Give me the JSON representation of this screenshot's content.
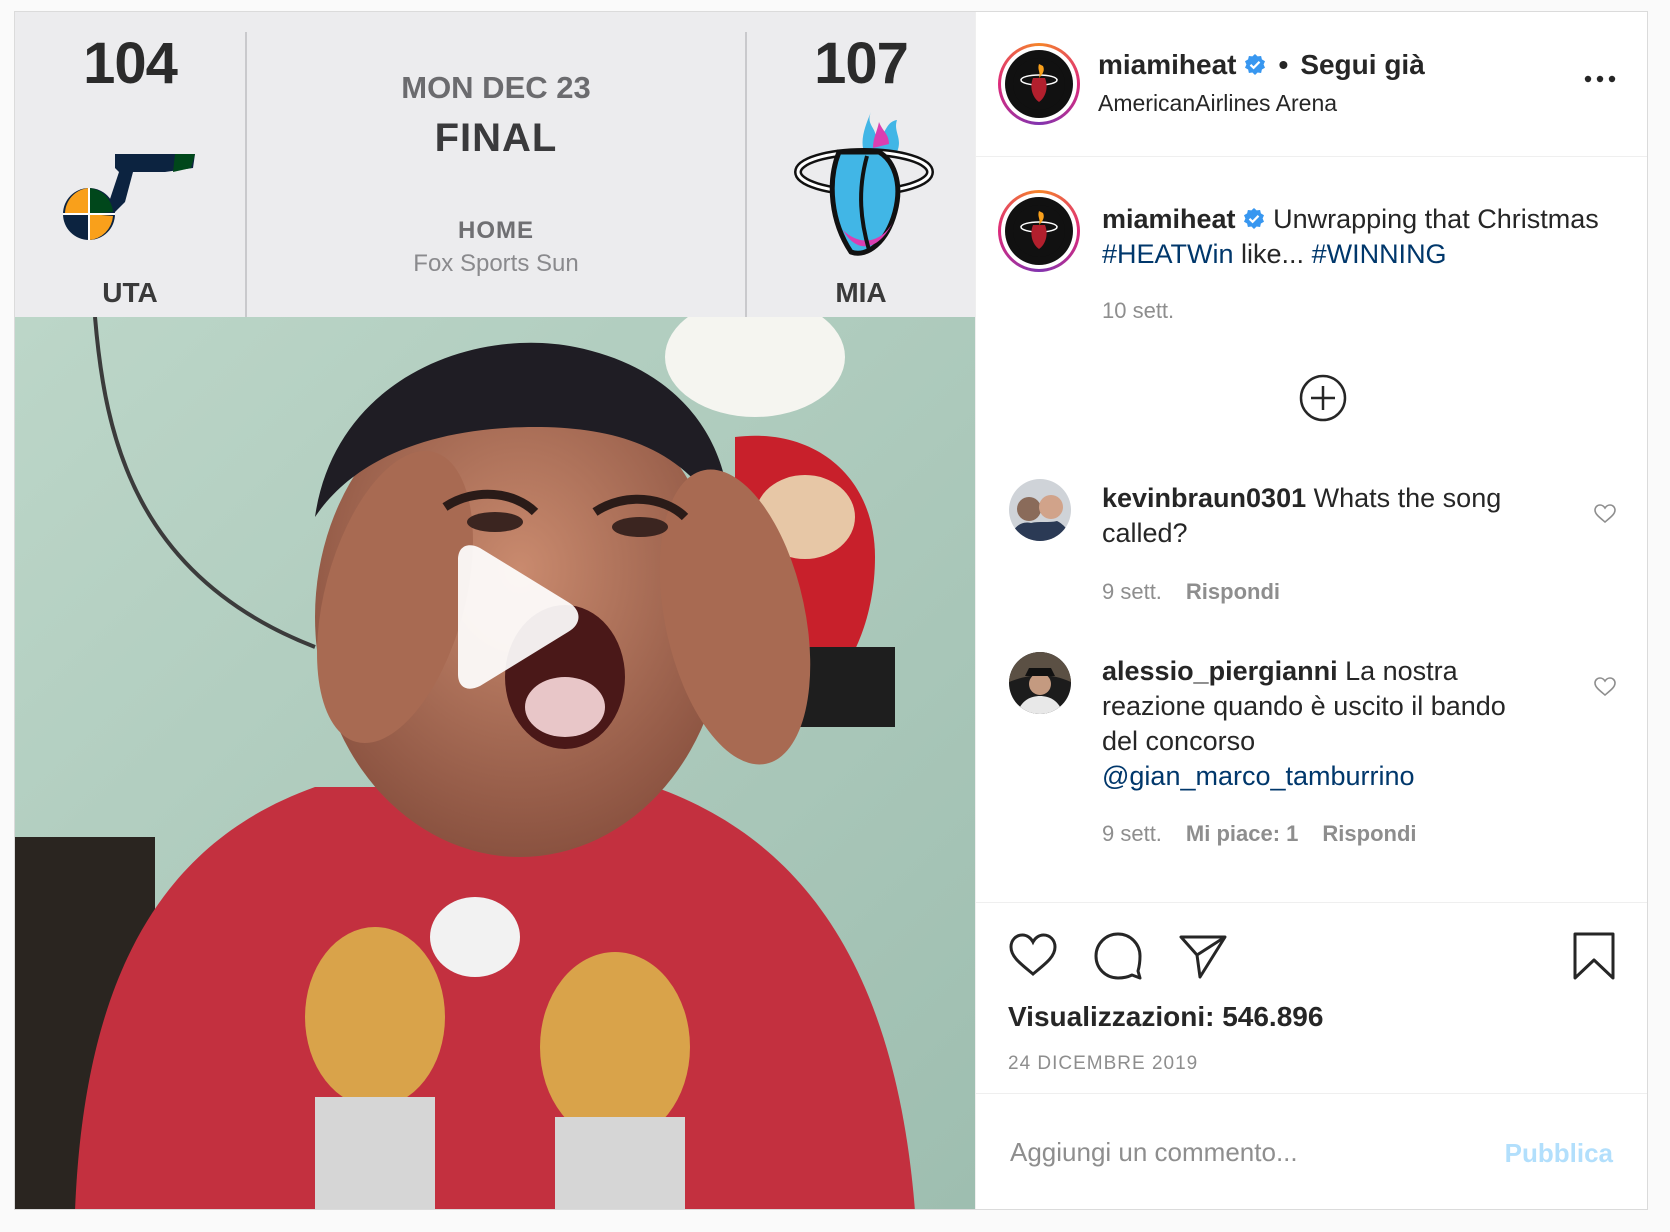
{
  "scoreboard": {
    "away": {
      "score": "104",
      "abbr": "UTA",
      "logo_icon": "utah-jazz-logo-icon"
    },
    "home": {
      "score": "107",
      "abbr": "MIA",
      "logo_icon": "miami-heat-logo-icon"
    },
    "date": "MON DEC 23",
    "status": "FINAL",
    "home_label": "HOME",
    "network": "Fox Sports Sun"
  },
  "header": {
    "username": "miamiheat",
    "separator": "•",
    "follow_label": "Segui già",
    "location": "AmericanAirlines Arena"
  },
  "caption": {
    "username": "miamiheat",
    "text_before": "Unwrapping that Christmas ",
    "hashtag1": "#HEATWin",
    "text_middle": " like... ",
    "hashtag2": "#WINNING",
    "time": "10 sett."
  },
  "comments": [
    {
      "username": "kevinbraun0301",
      "text": "Whats the song called?",
      "time": "9 sett.",
      "likes": "",
      "reply_label": "Rispondi"
    },
    {
      "username": "alessio_piergianni",
      "text": "La nostra reazione quando è uscito il bando del concorso",
      "mention": "@gian_marco_tamburrino",
      "time": "9 sett.",
      "likes": "Mi piace: 1",
      "reply_label": "Rispondi"
    }
  ],
  "stats": {
    "views": "Visualizzazioni: 546.896",
    "date": "24 DICEMBRE 2019"
  },
  "composer": {
    "placeholder": "Aggiungi un commento...",
    "publish_label": "Pubblica"
  },
  "colors": {
    "link": "#00376b",
    "verified": "#3897f0",
    "publish_disabled": "#b2dffc"
  }
}
